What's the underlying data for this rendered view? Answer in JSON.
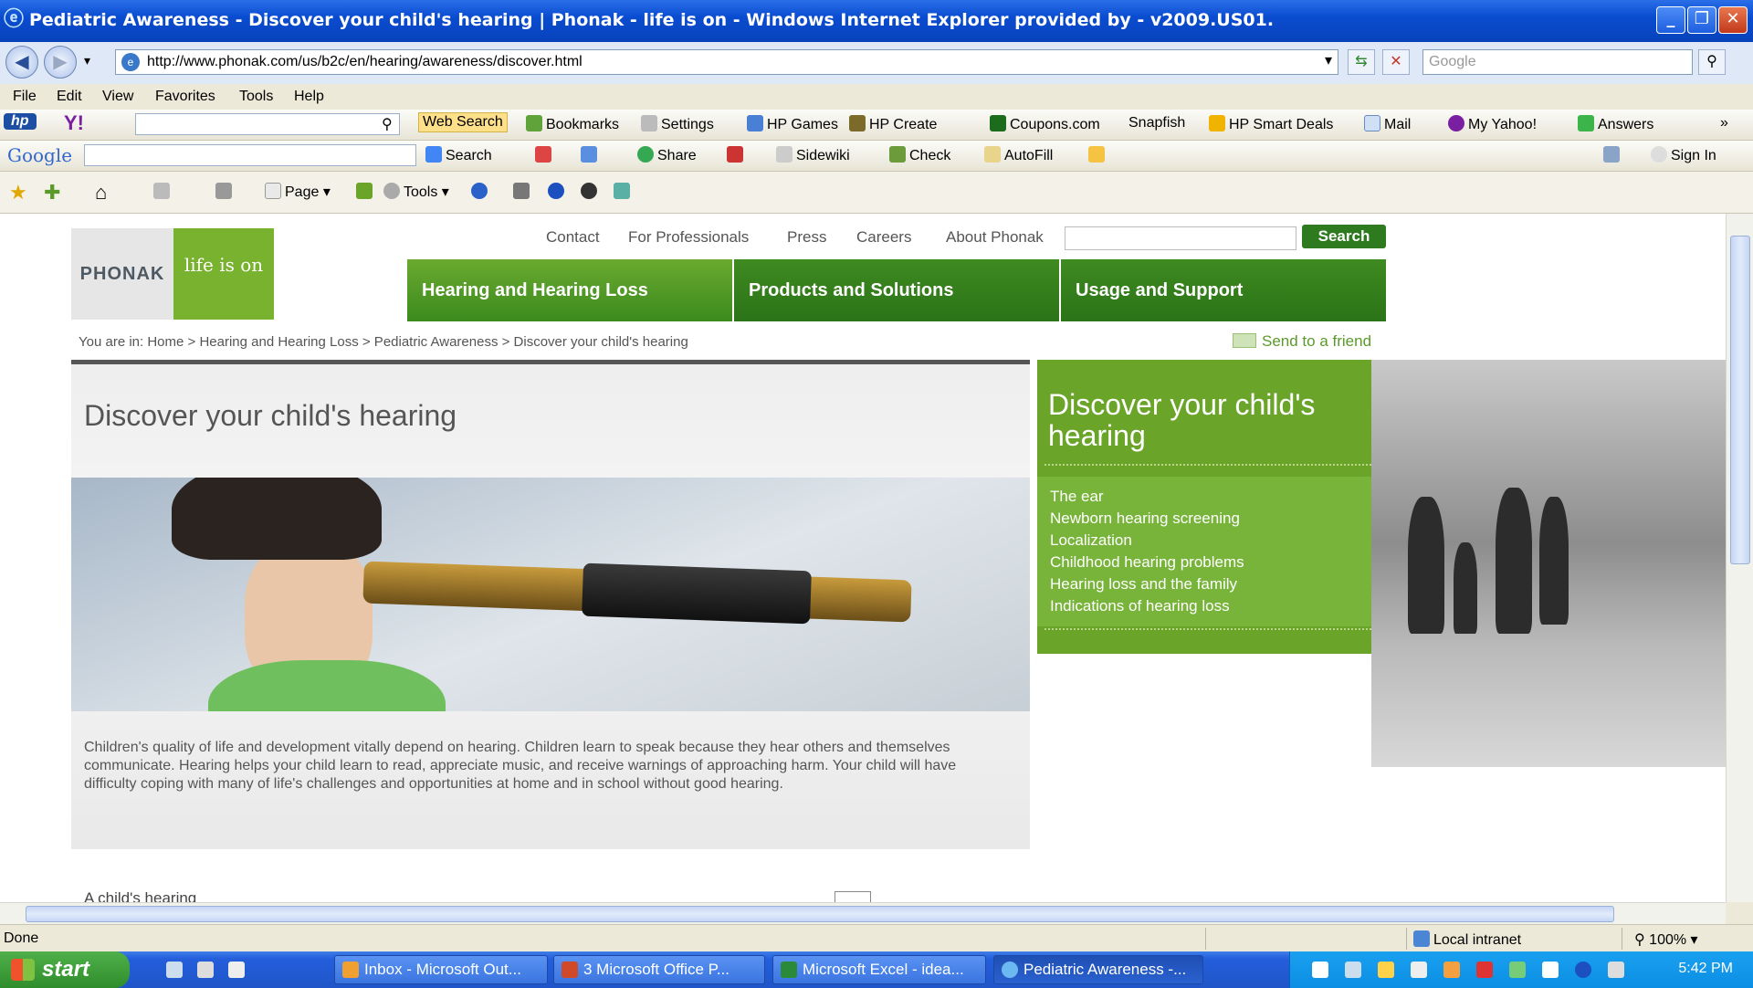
{
  "window": {
    "title": "Pediatric Awareness - Discover your child's hearing | Phonak - life is on - Windows Internet Explorer provided by - v2009.US01."
  },
  "address": {
    "url": "http://www.phonak.com/us/b2c/en/hearing/awareness/discover.html",
    "search_placeholder": "Google"
  },
  "menu": [
    "File",
    "Edit",
    "View",
    "Favorites",
    "Tools",
    "Help"
  ],
  "toolbar_hp": {
    "web_search": "Web Search",
    "bookmarks": "Bookmarks",
    "settings": "Settings",
    "hp_games": "HP Games",
    "hp_create": "HP Create",
    "coupons": "Coupons.com",
    "snapfish": "Snapfish",
    "hp_smart_deals": "HP Smart Deals",
    "mail": "Mail",
    "my_yahoo": "My Yahoo!",
    "answers": "Answers"
  },
  "toolbar_google": {
    "logo": "Google",
    "search": "Search",
    "share": "Share",
    "sidewiki": "Sidewiki",
    "check": "Check",
    "autofill": "AutoFill",
    "sign_in": "Sign In"
  },
  "toolbar_command": {
    "page": "Page",
    "tools": "Tools"
  },
  "site": {
    "logo_left": "PHONAK",
    "logo_right": "life is on",
    "top_links": [
      "Contact",
      "For Professionals",
      "Press",
      "Careers",
      "About Phonak"
    ],
    "search_button": "Search",
    "nav": [
      "Hearing and Hearing Loss",
      "Products and Solutions",
      "Usage and Support"
    ],
    "breadcrumb": "You are in:  Home > Hearing and Hearing Loss > Pediatric Awareness > Discover your child's hearing",
    "send_to_friend": "Send to a friend",
    "hero_title": "Discover your child's hearing",
    "hero_caption": "Children's quality of life and development vitally depend on hearing. Children learn to speak because they hear others and themselves communicate. Hearing helps your child learn to read, appreciate music, and receive warnings of approaching harm. Your child will have difficulty coping with many of life's challenges and opportunities at home and in school without good hearing.",
    "sidebox_title": "Discover your child's hearing",
    "sidebox_links": [
      "The ear",
      "Newborn hearing screening",
      "Localization",
      "Childhood hearing problems",
      "Hearing loss and the family",
      "Indications of hearing loss"
    ],
    "lower_heading": "A child's hearing"
  },
  "status": {
    "text": "Done",
    "zone": "Local intranet",
    "zoom": "100%"
  },
  "taskbar": {
    "start": "start",
    "tasks": [
      "Inbox - Microsoft Out...",
      "3 Microsoft Office P...",
      "Microsoft Excel - idea...",
      "Pediatric Awareness -..."
    ],
    "clock": "5:42 PM"
  },
  "colors": {
    "brand_green": "#6aa52a",
    "nav_green": "#3c8a1e",
    "xp_blue": "#245edb"
  }
}
